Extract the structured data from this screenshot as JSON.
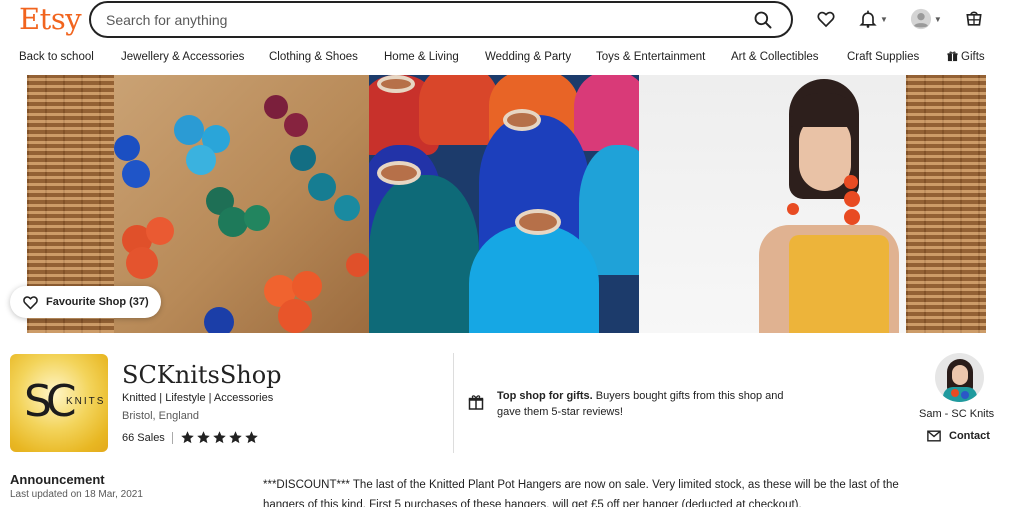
{
  "header": {
    "logo": "Etsy",
    "search_placeholder": "Search for anything",
    "icons": [
      "search-icon",
      "heart-icon",
      "bell-icon",
      "user-avatar-icon",
      "cart-icon"
    ]
  },
  "categories": [
    {
      "label": "Back to school"
    },
    {
      "label": "Jewellery & Accessories"
    },
    {
      "label": "Clothing & Shoes"
    },
    {
      "label": "Home & Living"
    },
    {
      "label": "Wedding & Party"
    },
    {
      "label": "Toys & Entertainment"
    },
    {
      "label": "Art & Collectibles"
    },
    {
      "label": "Craft Supplies"
    },
    {
      "label": "Gifts"
    }
  ],
  "favourite_button": "Favourite Shop (37)",
  "shop": {
    "logo_sc": "SC",
    "logo_knits": "KNITS",
    "name": "SCKnitsShop",
    "tags": "Knitted | Lifestyle | Accessories",
    "location": "Bristol, England",
    "sales": "66 Sales",
    "rating_stars": 5
  },
  "top_shop": {
    "bold": "Top shop for gifts.",
    "text": " Buyers bought gifts from this shop and gave them 5-star reviews!"
  },
  "owner": {
    "name": "Sam - SC Knits",
    "contact_label": "Contact"
  },
  "announcement": {
    "title": "Announcement",
    "date": "Last updated on 18 Mar, 2021",
    "text": "***DISCOUNT*** The last of the Knitted Plant Pot Hangers are now on sale. Very limited stock, as these will be the last of the hangers of this kind. First 5 purchases of these hangers, will get £5 off per hanger (deducted at checkout)."
  },
  "colors": {
    "brand": "#f1641e",
    "text": "#222222",
    "muted": "#595959"
  }
}
